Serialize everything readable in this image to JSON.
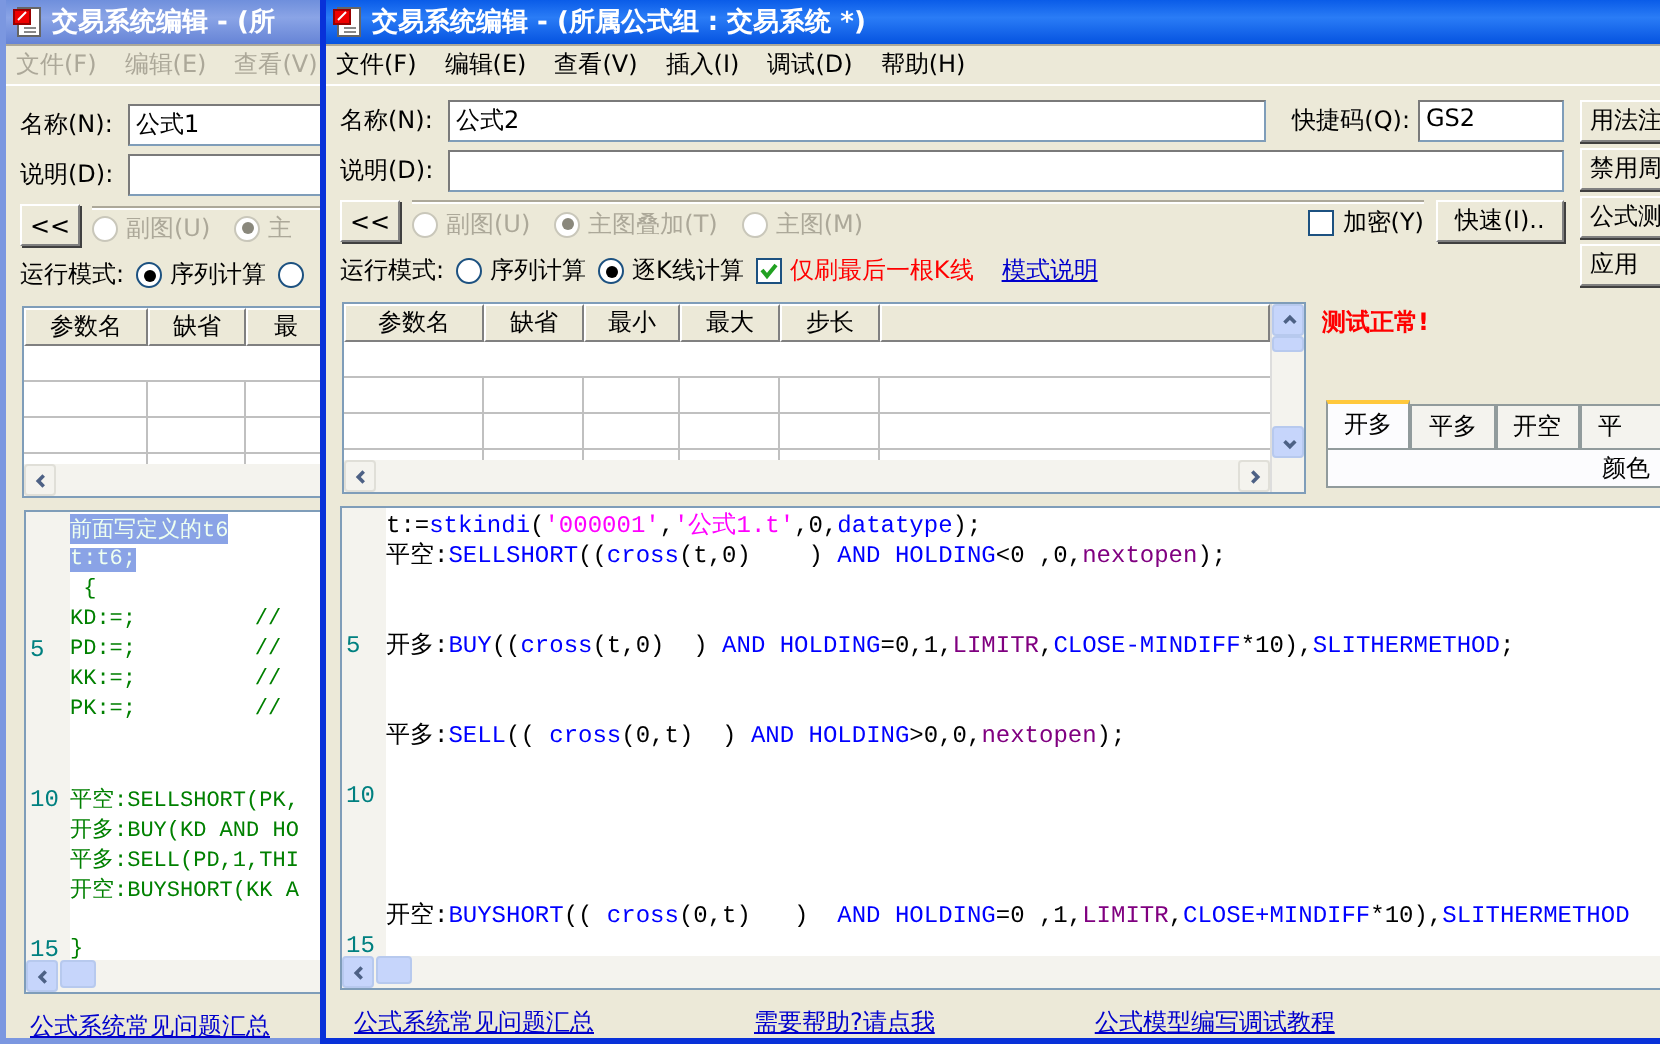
{
  "back_window": {
    "active": false,
    "title": "交易系统编辑 - (所",
    "menu": [
      "文件(F)",
      "编辑(E)",
      "查看(V)"
    ],
    "name_label": "名称(N):",
    "name_value": "公式1",
    "desc_label": "说明(D):",
    "collapse_button": "<<",
    "chart_radios": [
      {
        "label": "副图(U)",
        "selected": false,
        "disabled": true
      },
      {
        "label": "主",
        "selected": true,
        "disabled": true
      }
    ],
    "run_mode_label": "运行模式:",
    "run_mode_radios": [
      {
        "label": "序列计算",
        "selected": true
      },
      {
        "selected": false
      }
    ],
    "params": {
      "columns": [
        "参数名",
        "缺省",
        "最"
      ]
    },
    "code": {
      "lines": [
        {
          "selected": true,
          "tokens": [
            {
              "text": "前面写定义的t6",
              "kind": "legacy"
            }
          ]
        },
        {
          "selected": true,
          "tokens": [
            {
              "text": "t:t6;",
              "kind": "legacy"
            }
          ]
        },
        {
          "selected": false,
          "tokens": [
            {
              "text": " {",
              "kind": "legacy"
            }
          ]
        },
        {
          "selected": false,
          "tokens": [
            {
              "text": "KD:=;         //",
              "kind": "legacy"
            }
          ]
        },
        {
          "number": "5",
          "selected": false,
          "tokens": [
            {
              "text": "PD:=;         //",
              "kind": "legacy"
            }
          ]
        },
        {
          "selected": false,
          "tokens": [
            {
              "text": "KK:=;         //",
              "kind": "legacy"
            }
          ]
        },
        {
          "selected": false,
          "tokens": [
            {
              "text": "PK:=;         //",
              "kind": "legacy"
            }
          ]
        },
        {
          "kind": "blank"
        },
        {
          "kind": "blank"
        },
        {
          "number": "10",
          "selected": false,
          "tokens": [
            {
              "text": "平空:SELLSHORT(PK,",
              "kind": "legacy"
            }
          ]
        },
        {
          "selected": false,
          "tokens": [
            {
              "text": "开多:BUY(KD AND HO",
              "kind": "legacy"
            }
          ]
        },
        {
          "selected": false,
          "tokens": [
            {
              "text": "平多:SELL(PD,1,THI",
              "kind": "legacy"
            }
          ]
        },
        {
          "selected": false,
          "tokens": [
            {
              "text": "开空:BUYSHORT(KK A",
              "kind": "legacy"
            }
          ]
        },
        {
          "kind": "blank"
        },
        {
          "number": "15",
          "selected": false,
          "tokens": [
            {
              "text": "}",
              "kind": "legacy"
            }
          ]
        }
      ]
    },
    "links": [
      "公式系统常见问题汇总"
    ]
  },
  "front_window": {
    "active": true,
    "title": "交易系统编辑 - (所属公式组 : 交易系统 *)",
    "menu": [
      "文件(F)",
      "编辑(E)",
      "查看(V)",
      "插入(I)",
      "调试(D)",
      "帮助(H)"
    ],
    "name_label": "名称(N):",
    "name_value": "公式2",
    "shortcut_label": "快捷码(Q):",
    "shortcut_value": "GS2",
    "desc_label": "说明(D):",
    "collapse_button": "<<",
    "chart_radios": [
      {
        "label": "副图(U)",
        "selected": false,
        "disabled": true
      },
      {
        "label": "主图叠加(T)",
        "selected": true,
        "disabled": true
      },
      {
        "label": "主图(M)",
        "selected": false,
        "disabled": true
      }
    ],
    "encrypt": {
      "label": "加密(Y)",
      "checked": false
    },
    "quick_button": "快速(I)..",
    "run_mode_label": "运行模式:",
    "run_mode_radios": [
      {
        "label": "序列计算",
        "selected": false
      },
      {
        "label": "逐K线计算",
        "selected": true
      }
    ],
    "last_bar_only": {
      "label": "仅刷最后一根K线",
      "checked": true
    },
    "mode_help_link": "模式说明",
    "side_buttons": [
      "用法注",
      "禁用周",
      "公式测",
      "应用"
    ],
    "params": {
      "columns": [
        "参数名",
        "缺省",
        "最小",
        "最大",
        "步长"
      ]
    },
    "test_status": "测试正常!",
    "signal_tabs": [
      {
        "label": "开多",
        "selected": true
      },
      {
        "label": "平多",
        "selected": false
      },
      {
        "label": "开空",
        "selected": false
      },
      {
        "label": "平",
        "selected": false
      }
    ],
    "color_label": "颜色",
    "code": {
      "lines": [
        {
          "kind": "code",
          "tokens": [
            {
              "text": "t:=",
              "kind": "plain"
            },
            {
              "text": "stkindi",
              "kind": "func"
            },
            {
              "text": "(",
              "kind": "plain"
            },
            {
              "text": "'000001'",
              "kind": "string"
            },
            {
              "text": ",",
              "kind": "plain"
            },
            {
              "text": "'公式1.t'",
              "kind": "string"
            },
            {
              "text": ",0,",
              "kind": "plain"
            },
            {
              "text": "datatype",
              "kind": "func"
            },
            {
              "text": ");",
              "kind": "plain"
            }
          ]
        },
        {
          "kind": "code",
          "tokens": [
            {
              "text": "平空:",
              "kind": "plain"
            },
            {
              "text": "SELLSHORT",
              "kind": "func"
            },
            {
              "text": "((",
              "kind": "plain"
            },
            {
              "text": "cross",
              "kind": "func"
            },
            {
              "text": "(t,0)    ) ",
              "kind": "plain"
            },
            {
              "text": "AND HOLDING",
              "kind": "func"
            },
            {
              "text": "<0 ,0,",
              "kind": "plain"
            },
            {
              "text": "nextopen",
              "kind": "const"
            },
            {
              "text": ");",
              "kind": "plain"
            }
          ]
        },
        {
          "kind": "blank"
        },
        {
          "kind": "blank"
        },
        {
          "kind": "code",
          "number": "5",
          "tokens": [
            {
              "text": "开多:",
              "kind": "plain"
            },
            {
              "text": "BUY",
              "kind": "func"
            },
            {
              "text": "((",
              "kind": "plain"
            },
            {
              "text": "cross",
              "kind": "func"
            },
            {
              "text": "(t,0)  ) ",
              "kind": "plain"
            },
            {
              "text": "AND HOLDING",
              "kind": "func"
            },
            {
              "text": "=0,1,",
              "kind": "plain"
            },
            {
              "text": "LIMITR",
              "kind": "const"
            },
            {
              "text": ",",
              "kind": "plain"
            },
            {
              "text": "CLOSE-MINDIFF",
              "kind": "func"
            },
            {
              "text": "*10),",
              "kind": "plain"
            },
            {
              "text": "SLITHERMETHOD",
              "kind": "func"
            },
            {
              "text": ";",
              "kind": "plain"
            }
          ]
        },
        {
          "kind": "blank"
        },
        {
          "kind": "blank"
        },
        {
          "kind": "code",
          "tokens": [
            {
              "text": "平多:",
              "kind": "plain"
            },
            {
              "text": "SELL",
              "kind": "func"
            },
            {
              "text": "(( ",
              "kind": "plain"
            },
            {
              "text": "cross",
              "kind": "func"
            },
            {
              "text": "(0,t)  ) ",
              "kind": "plain"
            },
            {
              "text": "AND HOLDING",
              "kind": "func"
            },
            {
              "text": ">0,0,",
              "kind": "plain"
            },
            {
              "text": "nextopen",
              "kind": "const"
            },
            {
              "text": ");",
              "kind": "plain"
            }
          ]
        },
        {
          "kind": "blank"
        },
        {
          "kind": "blank",
          "number": "10"
        },
        {
          "kind": "blank"
        },
        {
          "kind": "blank"
        },
        {
          "kind": "blank"
        },
        {
          "kind": "code",
          "tokens": [
            {
              "text": "开空:",
              "kind": "plain"
            },
            {
              "text": "BUYSHORT",
              "kind": "func"
            },
            {
              "text": "(( ",
              "kind": "plain"
            },
            {
              "text": "cross",
              "kind": "func"
            },
            {
              "text": "(0,t)   )  ",
              "kind": "plain"
            },
            {
              "text": "AND HOLDING",
              "kind": "func"
            },
            {
              "text": "=0 ,1,",
              "kind": "plain"
            },
            {
              "text": "LIMITR",
              "kind": "const"
            },
            {
              "text": ",",
              "kind": "plain"
            },
            {
              "text": "CLOSE+MINDIFF",
              "kind": "func"
            },
            {
              "text": "*10),",
              "kind": "plain"
            },
            {
              "text": "SLITHERMETHOD",
              "kind": "func"
            }
          ]
        },
        {
          "kind": "blank",
          "number": "15"
        }
      ]
    },
    "links": [
      "公式系统常见问题汇总",
      "需要帮助?请点我",
      "公式模型编写调试教程"
    ]
  }
}
